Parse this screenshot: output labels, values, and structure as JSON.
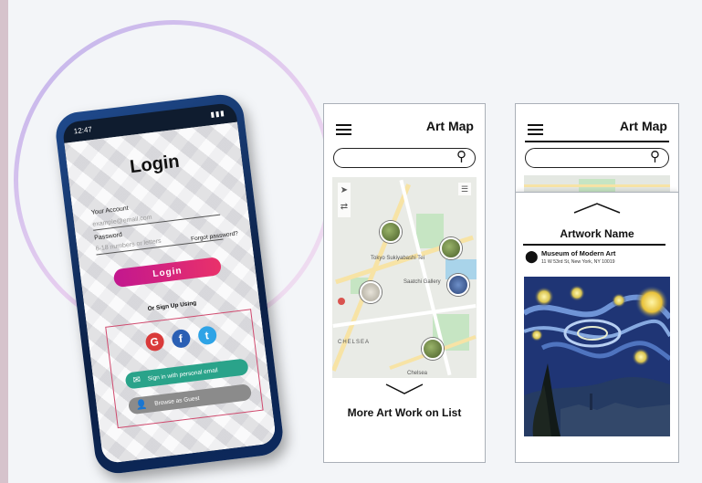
{
  "phone": {
    "status_time": "12:47",
    "status_icons": "▮▮▮",
    "login_title": "Login",
    "account_label": "Your Account",
    "account_placeholder": "example@email.com",
    "password_label": "Password",
    "password_placeholder": "6-18 numbers or letters",
    "forgot_password": "Forgot password?",
    "login_button": "Login",
    "or_sign_up": "Or Sign Up Using",
    "social": {
      "google": "G",
      "facebook": "f",
      "twitter": "t"
    },
    "email_signin": "Sign in with personal email",
    "guest_browse": "Browse as Guest",
    "colors": {
      "login_gradient_start": "#c2178f",
      "login_gradient_end": "#e9316a",
      "email_button": "#2aa38a",
      "guest_button": "#8b8b8b"
    }
  },
  "map_screen": {
    "title": "Art Map",
    "search_placeholder": "",
    "map_labels": {
      "sukiyabashi": "Tokyo Sukiyabashi Tei",
      "gallery": "Saatchi Gallery",
      "chelsea": "CHELSEA",
      "chelsea_label": "Chelsea"
    },
    "more_link": "More Art Work on List"
  },
  "detail_screen": {
    "title": "Art Map",
    "artwork_name": "Artwork Name",
    "museum_name": "Museum of Modern Art",
    "museum_address": "11 W 53rd St, New York, NY 10019"
  },
  "icons": [
    "hamburger-icon",
    "search-icon",
    "chevron-down-icon",
    "chevron-up-icon",
    "location-pin-icon",
    "email-icon",
    "user-icon",
    "google-icon",
    "facebook-icon",
    "twitter-icon"
  ]
}
